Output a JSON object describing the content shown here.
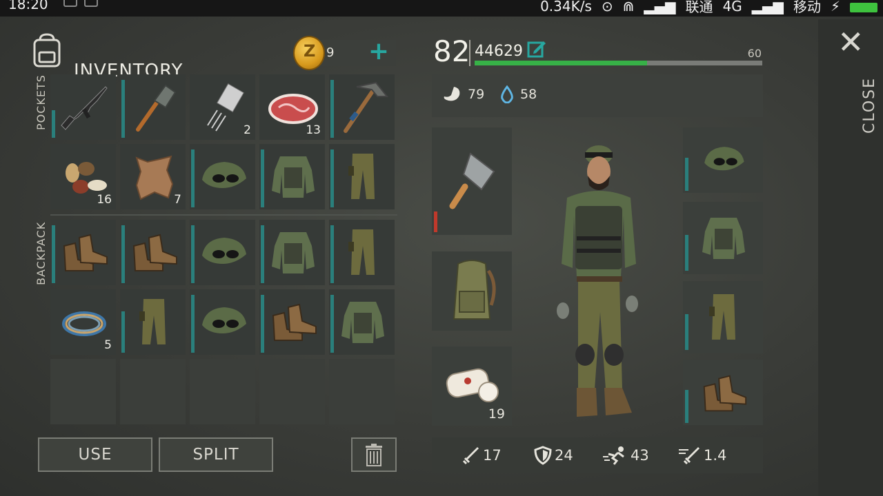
{
  "status": {
    "time": "18:20",
    "network_speed": "0.34K/s",
    "carrier1": "联通",
    "net_type": "4G",
    "carrier2": "移动"
  },
  "inventory": {
    "title": "INVENTORY",
    "coins": "9",
    "add_label": "+",
    "pockets_label": "POCKETS",
    "backpack_label": "BACKPACK",
    "pockets": [
      {
        "item": "assault-rifle",
        "qty": ""
      },
      {
        "item": "shovel",
        "qty": ""
      },
      {
        "item": "transistor",
        "qty": "2"
      },
      {
        "item": "raw-meat",
        "qty": "13"
      },
      {
        "item": "pickaxe",
        "qty": ""
      },
      {
        "item": "nuts",
        "qty": "16"
      },
      {
        "item": "animal-hide",
        "qty": "7"
      },
      {
        "item": "camo-cap",
        "qty": ""
      },
      {
        "item": "camo-vest",
        "qty": ""
      },
      {
        "item": "camo-pants",
        "qty": ""
      }
    ],
    "backpack": [
      {
        "item": "boots",
        "qty": ""
      },
      {
        "item": "boots",
        "qty": ""
      },
      {
        "item": "camo-cap",
        "qty": ""
      },
      {
        "item": "camo-vest",
        "qty": ""
      },
      {
        "item": "camo-pants",
        "qty": ""
      },
      {
        "item": "wire",
        "qty": "5"
      },
      {
        "item": "camo-pants",
        "qty": ""
      },
      {
        "item": "camo-cap",
        "qty": ""
      },
      {
        "item": "boots",
        "qty": ""
      },
      {
        "item": "camo-vest",
        "qty": ""
      }
    ]
  },
  "buttons": {
    "use": "USE",
    "split": "SPLIT"
  },
  "character": {
    "level": "82",
    "xp": "44629",
    "xp_max": "60",
    "xp_progress": 0.6,
    "food": "79",
    "water": "58",
    "bandage_qty": "19",
    "attack": "17",
    "defense": "24",
    "speed": "43",
    "weapon_speed": "1.4"
  },
  "close_label": "CLOSE",
  "colors": {
    "accent": "#27a7a0",
    "xp_bar": "#37b147",
    "durability": "#2a7f7c",
    "low_durability": "#c0392b"
  }
}
